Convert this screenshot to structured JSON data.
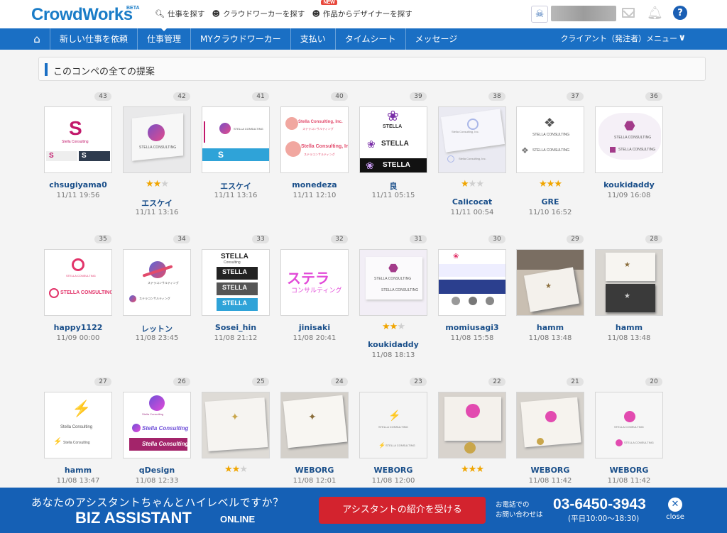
{
  "header": {
    "logo": "CrowdWorks",
    "logo_badge": "BETA",
    "links": [
      {
        "label": "仕事を探す",
        "icon": "search-icon"
      },
      {
        "label": "クラウドワーカーを探す",
        "icon": "people-icon"
      },
      {
        "label": "作品からデザイナーを探す",
        "icon": "people-icon",
        "badge": "NEW"
      }
    ],
    "help": "?"
  },
  "nav": {
    "items": [
      "新しい仕事を依頼",
      "仕事管理",
      "MYクラウドワーカー",
      "支払い",
      "タイムシート",
      "メッセージ"
    ],
    "active_index": 1,
    "client_menu": "クライアント（発注者）メニュー"
  },
  "section": {
    "title": "このコンペの全ての提案"
  },
  "entries": [
    {
      "num": "43",
      "user": "chsugiyama0",
      "date": "11/11 19:56",
      "stars": 0
    },
    {
      "num": "42",
      "user": "エスケイ",
      "date": "11/11 13:16",
      "stars": 2
    },
    {
      "num": "41",
      "user": "エスケイ",
      "date": "11/11 13:16",
      "stars": 0
    },
    {
      "num": "40",
      "user": "monedeza",
      "date": "11/11 12:10",
      "stars": 0
    },
    {
      "num": "39",
      "user": "良",
      "date": "11/11 05:15",
      "stars": 0
    },
    {
      "num": "38",
      "user": "Calicocat",
      "date": "11/11 00:54",
      "stars": 1
    },
    {
      "num": "37",
      "user": "GRE",
      "date": "11/10 16:52",
      "stars": 3
    },
    {
      "num": "36",
      "user": "koukidaddy",
      "date": "11/09 16:08",
      "stars": 0
    },
    {
      "num": "35",
      "user": "happy1122",
      "date": "11/09 00:00",
      "stars": 0
    },
    {
      "num": "34",
      "user": "レットン",
      "date": "11/08 23:45",
      "stars": 0
    },
    {
      "num": "33",
      "user": "Sosei_hin",
      "date": "11/08 21:12",
      "stars": 0
    },
    {
      "num": "32",
      "user": "jinisaki",
      "date": "11/08 20:41",
      "stars": 0
    },
    {
      "num": "31",
      "user": "koukidaddy",
      "date": "11/08 18:13",
      "stars": 2
    },
    {
      "num": "30",
      "user": "momiusagi3",
      "date": "11/08 15:58",
      "stars": 0
    },
    {
      "num": "29",
      "user": "hamm",
      "date": "11/08 13:48",
      "stars": 0
    },
    {
      "num": "28",
      "user": "hamm",
      "date": "11/08 13:48",
      "stars": 0
    },
    {
      "num": "27",
      "user": "hamm",
      "date": "11/08 13:47",
      "stars": 0
    },
    {
      "num": "26",
      "user": "qDesign",
      "date": "11/08 12:33",
      "stars": 0
    },
    {
      "num": "25",
      "user": "",
      "date": "",
      "stars": 2
    },
    {
      "num": "24",
      "user": "WEBORG",
      "date": "11/08 12:01",
      "stars": 0
    },
    {
      "num": "23",
      "user": "WEBORG",
      "date": "11/08 12:00",
      "stars": 0
    },
    {
      "num": "22",
      "user": "",
      "date": "",
      "stars": 3
    },
    {
      "num": "21",
      "user": "WEBORG",
      "date": "11/08 11:42",
      "stars": 0
    },
    {
      "num": "20",
      "user": "WEBORG",
      "date": "11/08 11:42",
      "stars": 0
    }
  ],
  "thumb_text": {
    "stella_consulting": "STELLA CONSULTING",
    "stella_consulting_mixed": "Stella Consulting",
    "stella_consulting_inc": "Stella Consulting, Inc.",
    "stella": "STELLA",
    "consulting": "Consulting",
    "stella_kana": "ステラ",
    "consulting_kana": "コンサルティング",
    "stella_consulting_kana": "ステラコンサルティング"
  },
  "banner": {
    "question": "あなたのアシスタントちゃんとハイレベルですか？",
    "brand": "BIZ ASSISTANT",
    "brand_sub": "ONLINE",
    "button": "アシスタントの紹介を受ける",
    "phone_label_1": "お電話での",
    "phone_label_2": "お問い合わせは",
    "phone": "03-6450-3943",
    "hours": "(平日10:00〜18:30)",
    "close_label": "close"
  },
  "colors": {
    "brand_blue": "#1a6fc4",
    "star": "#f0a500",
    "banner": "#1560b5",
    "button_red": "#d3232e"
  }
}
